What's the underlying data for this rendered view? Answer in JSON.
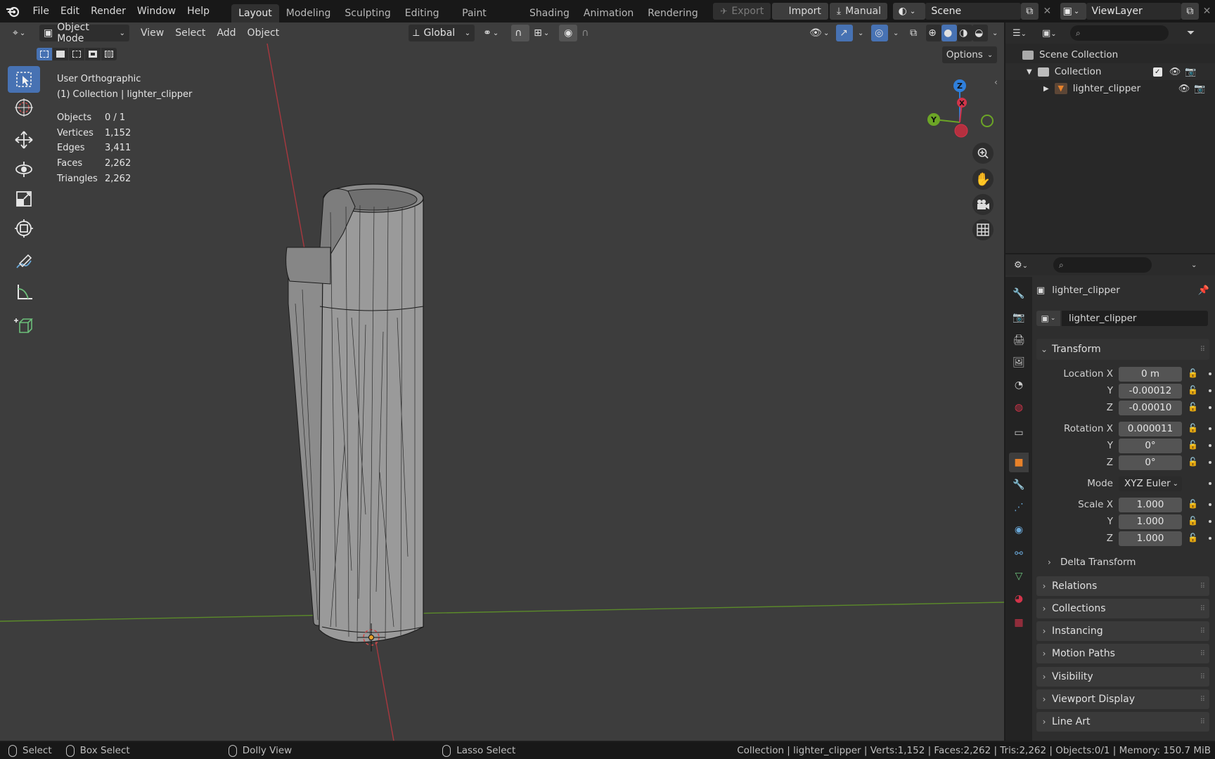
{
  "topbar": {
    "menus": [
      "File",
      "Edit",
      "Render",
      "Window",
      "Help"
    ],
    "workspaces": [
      "Layout",
      "Modeling",
      "Sculpting",
      "UV Editing",
      "Texture Paint",
      "Shading",
      "Animation",
      "Rendering"
    ],
    "active_workspace": "Layout",
    "export_label": "Export",
    "import_label": "Import",
    "manual_label": "Manual",
    "scene_name": "Scene",
    "view_layer": "ViewLayer"
  },
  "viewport": {
    "mode": "Object Mode",
    "menus": [
      "View",
      "Select",
      "Add",
      "Object"
    ],
    "orientation": "Global",
    "options_label": "Options",
    "view_name": "User Orthographic",
    "collection_info": "(1) Collection | lighter_clipper",
    "stats": [
      {
        "label": "Objects",
        "value": "0 / 1"
      },
      {
        "label": "Vertices",
        "value": "1,152"
      },
      {
        "label": "Edges",
        "value": "3,411"
      },
      {
        "label": "Faces",
        "value": "2,262"
      },
      {
        "label": "Triangles",
        "value": "2,262"
      }
    ],
    "gizmo_axes": {
      "z": "Z",
      "y": "Y",
      "x": "X"
    }
  },
  "outliner": {
    "scene_collection": "Scene Collection",
    "collection": "Collection",
    "object": "lighter_clipper"
  },
  "properties": {
    "object_name": "lighter_clipper",
    "data_name": "lighter_clipper",
    "transform_label": "Transform",
    "location": {
      "label": "Location X",
      "x": "0 m",
      "y": "-0.00012",
      "z": "-0.00010"
    },
    "rotation": {
      "label": "Rotation X",
      "x": "0.000011",
      "y": "0°",
      "z": "0°"
    },
    "mode_label": "Mode",
    "mode_value": "XYZ Euler",
    "scale": {
      "label": "Scale X",
      "x": "1.000",
      "y": "1.000",
      "z": "1.000"
    },
    "axis_y": "Y",
    "axis_z": "Z",
    "delta_transform": "Delta Transform",
    "panels": [
      "Relations",
      "Collections",
      "Instancing",
      "Motion Paths",
      "Visibility",
      "Viewport Display",
      "Line Art"
    ]
  },
  "statusbar": {
    "select": "Select",
    "box_select": "Box Select",
    "dolly_view": "Dolly View",
    "lasso_select": "Lasso Select",
    "info": "Collection | lighter_clipper | Verts:1,152 | Faces:2,262 | Tris:2,262 | Objects:0/1 | Memory: 150.7 MiB"
  },
  "colors": {
    "accent_blue": "#4772b3",
    "x_axis": "#d2344a",
    "y_axis": "#6ca526",
    "z_axis": "#2f7fdb",
    "object_orange": "#e8822a"
  }
}
